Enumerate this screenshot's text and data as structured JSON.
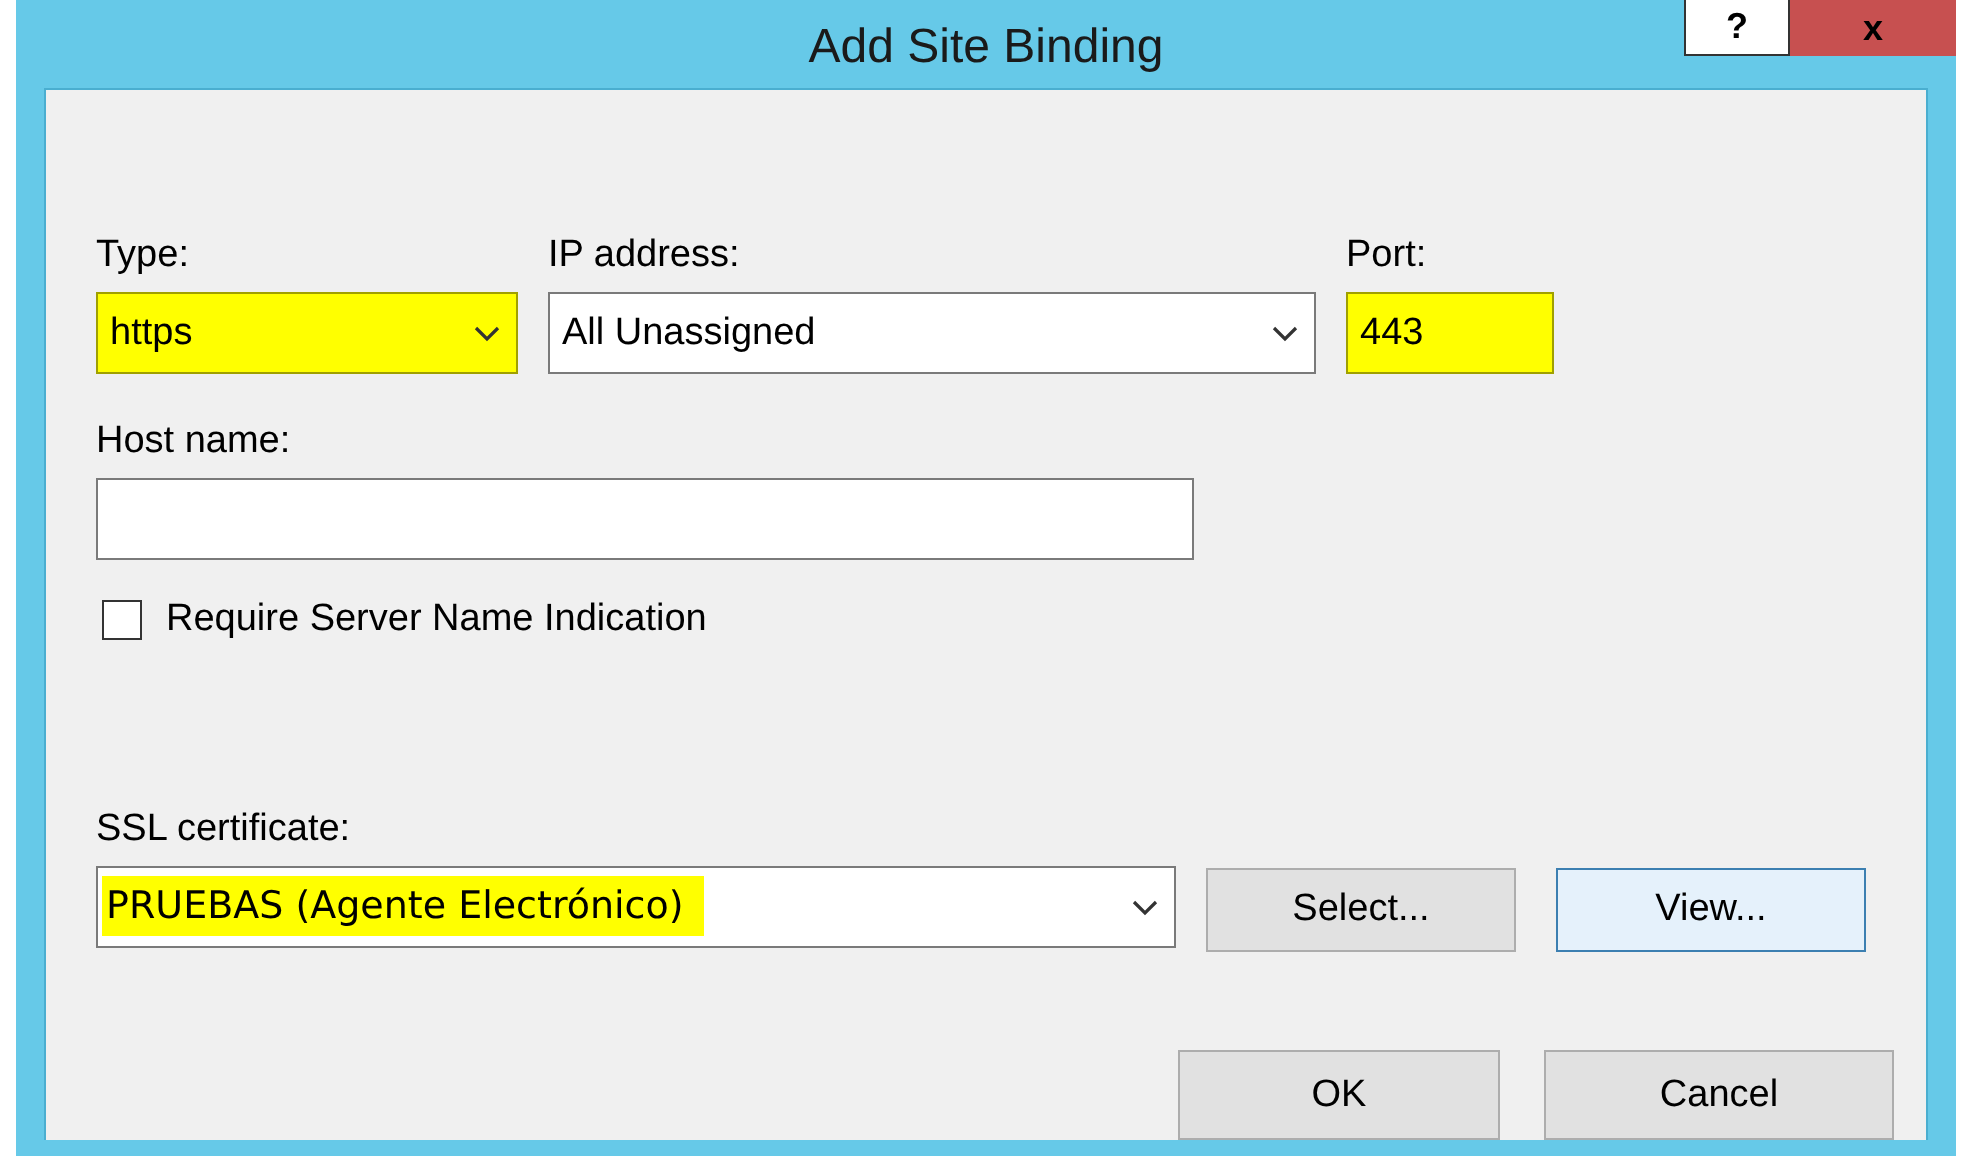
{
  "window": {
    "title": "Add Site Binding",
    "buttons": [
      {
        "kind": "help",
        "label": "?"
      },
      {
        "kind": "close",
        "label": "x"
      }
    ]
  },
  "type": {
    "label": "Type:",
    "value": "https",
    "highlighted": true
  },
  "ip_address": {
    "label": "IP address:",
    "value": "All Unassigned",
    "highlighted": false
  },
  "port": {
    "label": "Port:",
    "value": "443",
    "highlighted": true
  },
  "host_name": {
    "label": "Host name:"
  },
  "require_sni": {
    "label": "Require Server Name Indication",
    "checked": false
  },
  "ssl_certificate": {
    "label": "SSL certificate:",
    "value": "PRUEBAS (Agente Electrónico)",
    "highlighted": true
  },
  "certificate_buttons": [
    {
      "label": "Select...",
      "focused": false
    },
    {
      "label": "View...",
      "focused": true
    }
  ],
  "buttons": [
    "OK",
    "Cancel"
  ]
}
